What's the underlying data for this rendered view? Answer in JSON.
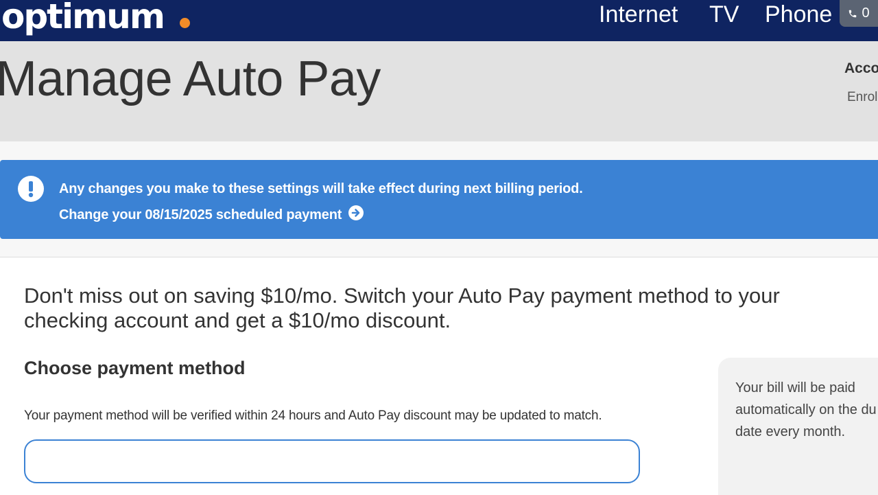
{
  "brand": {
    "logo_text": "optimum",
    "dot_color": "#f28c28",
    "nav_bg": "#0f2461"
  },
  "nav": {
    "internet": "Internet",
    "tv": "TV",
    "phone": "Phone",
    "cart_count": "0",
    "cart_icon": "phone-icon"
  },
  "header": {
    "title": "Manage Auto Pay",
    "account_label": "Acco",
    "enrolled_label": "Enrol"
  },
  "alert": {
    "icon": "exclamation-icon",
    "message": "Any changes you make to these settings will take effect during next billing period.",
    "link_text": "Change your 08/15/2025 scheduled payment",
    "link_icon": "arrow-right-circle-icon",
    "color": "#3b82d4"
  },
  "main": {
    "promo_text": "Don't miss out on saving $10/mo. Switch your Auto Pay payment method to your checking account and get a $10/mo discount.",
    "section_title": "Choose payment method",
    "verify_note": "Your payment method will be verified within 24 hours and Auto Pay discount may be updated to match."
  },
  "side_card": {
    "text": "Your bill will be paid\nautomatically on the du\ndate every month."
  }
}
